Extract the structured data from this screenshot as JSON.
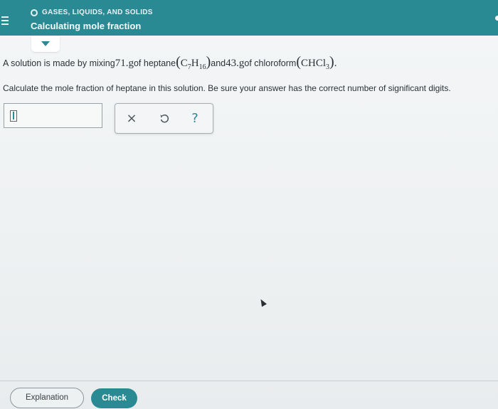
{
  "header": {
    "topic": "GASES, LIQUIDS, AND SOLIDS",
    "title": "Calculating mole fraction",
    "accent_color": "#2a8a93"
  },
  "problem": {
    "prefix": "A solution is made by mixing ",
    "mass1": "71.",
    "unit1": " g",
    "of_heptane": " of heptane ",
    "heptane_C": "C",
    "heptane_C_sub": "7",
    "heptane_H": "H",
    "heptane_H_sub": "16",
    "and": " and ",
    "mass2": "43.",
    "unit2": " g",
    "of_chloroform": " of chloroform ",
    "chloroform": "CHCl",
    "chloroform_sub": "3",
    "period": "."
  },
  "question": "Calculate the mole fraction of heptane in this solution. Be sure your answer has the correct number of significant digits.",
  "answer": {
    "value": ""
  },
  "tools": {
    "clear_icon": "close-icon",
    "clear_glyph": "×",
    "undo_icon": "undo-icon",
    "help_icon": "help-icon",
    "help_glyph": "?"
  },
  "footer": {
    "explanation_label": "Explanation",
    "check_label": "Check"
  }
}
